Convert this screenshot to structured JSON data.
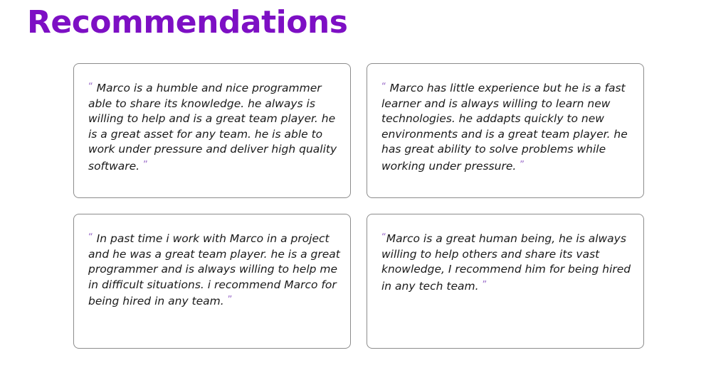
{
  "header": {
    "title": "Recommendations"
  },
  "testimonials": [
    {
      "open_mark": "“",
      "text": " Marco is a humble and nice programmer able to share its knowledge. he always is willing to help and is a great team player. he is a great asset for any team. he is able to work under pressure and deliver high quality software. ",
      "close_mark": "”"
    },
    {
      "open_mark": "“",
      "text": " Marco has little experience but he is a fast learner and is always willing to learn new technologies. he addapts quickly to new environments and is a great team player. he has great ability to solve problems while working under pressure. ",
      "close_mark": "”"
    },
    {
      "open_mark": "“",
      "text": " In past time i work with Marco in a project and he was a great team player. he is a great programmer and is always willing to help me in difficult situations. i recommend Marco for being hired in any team. ",
      "close_mark": "”"
    },
    {
      "open_mark": "“",
      "text": "Marco is a great human being, he is always willing to help others and share its vast knowledge, I recommend him for being hired in any tech team. ",
      "close_mark": "”"
    }
  ],
  "colors": {
    "title": "#7d0fc4",
    "quote_mark": "#9a6bc9",
    "card_border": "#8c8c8c",
    "text": "#1a1a1a"
  }
}
